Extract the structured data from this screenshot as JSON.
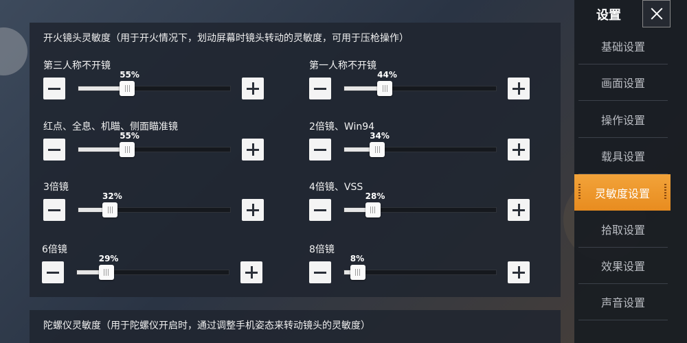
{
  "colors": {
    "accent": "#ec9427",
    "panel": "#202630",
    "sidebar": "#181c22"
  },
  "sidebar": {
    "title": "设置",
    "close_icon": "close-icon",
    "items": [
      {
        "label": "基础设置",
        "active": false
      },
      {
        "label": "画面设置",
        "active": false
      },
      {
        "label": "操作设置",
        "active": false
      },
      {
        "label": "载具设置",
        "active": false
      },
      {
        "label": "灵敏度设置",
        "active": true
      },
      {
        "label": "拾取设置",
        "active": false
      },
      {
        "label": "效果设置",
        "active": false
      },
      {
        "label": "声音设置",
        "active": false
      }
    ]
  },
  "fire_section": {
    "title": "开火镜头灵敏度（用于开火情况下，划动屏幕时镜头转动的灵敏度，可用于压枪操作）",
    "sliders": [
      {
        "label": "第三人称不开镜",
        "value": 55,
        "display": "55%"
      },
      {
        "label": "第一人称不开镜",
        "value": 44,
        "display": "44%"
      },
      {
        "label": "红点、全息、机瞄、侧面瞄准镜",
        "value": 55,
        "display": "55%"
      },
      {
        "label": "2倍镜、Win94",
        "value": 34,
        "display": "34%"
      },
      {
        "label": "3倍镜",
        "value": 32,
        "display": "32%"
      },
      {
        "label": "4倍镜、VSS",
        "value": 28,
        "display": "28%"
      },
      {
        "label": "6倍镜",
        "value": 29,
        "display": "29%"
      },
      {
        "label": "8倍镜",
        "value": 8,
        "display": "8%"
      }
    ]
  },
  "gyro_section": {
    "title": "陀螺仪灵敏度（用于陀螺仪开启时，通过调整手机姿态来转动镜头的灵敏度）"
  }
}
